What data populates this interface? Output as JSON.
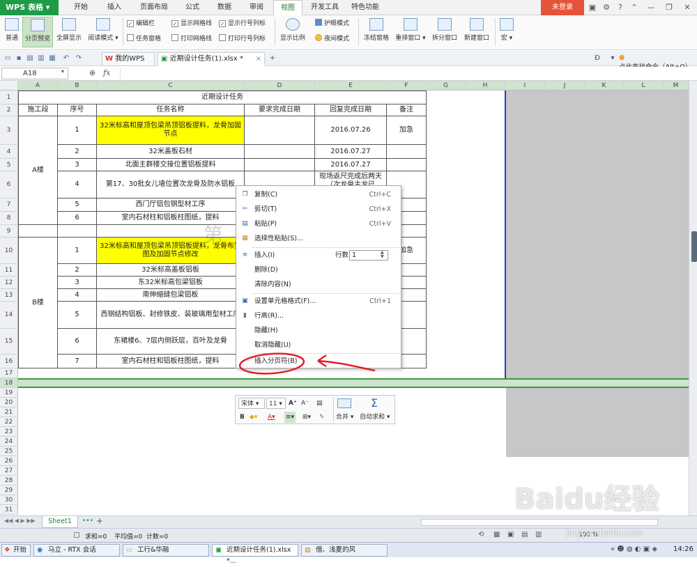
{
  "app": {
    "title": "WPS 表格",
    "login_label": "未登录"
  },
  "menu": {
    "tabs": [
      "开始",
      "插入",
      "页面布局",
      "公式",
      "数据",
      "审阅",
      "视图",
      "开发工具",
      "特色功能"
    ],
    "active": "视图"
  },
  "ribbon": {
    "normal": "普通",
    "page_break_preview": "分页预览",
    "full_screen": "全屏显示",
    "reading_mode": "阅读模式",
    "checks": {
      "formula_bar": "编辑栏",
      "task_pane": "任务窗格",
      "show_gridlines": "显示网格线",
      "print_gridlines": "打印网格线",
      "show_headers": "显示行号列标",
      "print_headers": "打印行号列标"
    },
    "zoom": "显示比例",
    "eye_mode": "护眼模式",
    "night_mode": "夜间模式",
    "freeze": "冻结窗格",
    "arrange": "重排窗口",
    "split": "拆分窗口",
    "new_window": "新建窗口",
    "macro": "宏"
  },
  "doctabs": {
    "home": "我的WPS",
    "file": "近期设计任务(1).xlsx *",
    "search": "点此查找命令（Alt+Q）"
  },
  "formula": {
    "name_box": "A18",
    "fx": "fx"
  },
  "columns": [
    "A",
    "B",
    "C",
    "D",
    "E",
    "F",
    "G",
    "H",
    "I",
    "J",
    "K",
    "L",
    "M"
  ],
  "rows": [
    "1",
    "2",
    "3",
    "4",
    "5",
    "6",
    "7",
    "8",
    "9",
    "10",
    "11",
    "12",
    "13",
    "14",
    "15",
    "16",
    "17",
    "18",
    "19",
    "20",
    "21",
    "22",
    "23",
    "24",
    "25",
    "26",
    "27",
    "28",
    "29",
    "30",
    "31",
    "32",
    "33",
    "34"
  ],
  "table": {
    "title": "近期设计任务",
    "headers": [
      "施工段",
      "序号",
      "任务名称",
      "要求完成日期",
      "回复完成日期",
      "备注"
    ],
    "section_a": "A楼",
    "section_b": "B楼",
    "rows_a": [
      {
        "no": "1",
        "task": "32米标高和屋顶包梁吊顶铝板提料，龙骨加固节点",
        "reply": "2016.07.26",
        "note": "加急"
      },
      {
        "no": "2",
        "task": "32米盖板石材",
        "reply": "2016.07.27",
        "note": ""
      },
      {
        "no": "3",
        "task": "北面主群楼交接位置铝板提料",
        "reply": "2016.07.27",
        "note": ""
      },
      {
        "no": "4",
        "task": "第17、30批女儿墙位置次龙骨及防水铝板",
        "reply": "现场返尺完成后两天（次龙骨主龙已",
        "note": ""
      },
      {
        "no": "5",
        "task": "西门厅铝包钢型材工序",
        "reply": "",
        "note": ""
      },
      {
        "no": "6",
        "task": "室内石材柱和铝板柱图纸，提料",
        "reply": "",
        "note": ""
      }
    ],
    "rows_b": [
      {
        "no": "1",
        "task": "32米标高和屋顶包梁吊顶铝板提料，龙骨布置图及加固节点修改",
        "reply": "",
        "note": "加急"
      },
      {
        "no": "2",
        "task": "32米标高盖板铝板",
        "reply": "",
        "note": ""
      },
      {
        "no": "3",
        "task": "东32米标高包梁铝板",
        "reply": "",
        "note": ""
      },
      {
        "no": "4",
        "task": "南伸缩缝包梁铝板",
        "reply": "",
        "note": ""
      },
      {
        "no": "5",
        "task": "西钢结构铝板、封修铁皮、装玻璃用型材工序",
        "reply": "",
        "note": ""
      },
      {
        "no": "6",
        "task": "东裙楼6、7层内侧跃层，百叶及龙骨",
        "reply": "",
        "note": ""
      },
      {
        "no": "7",
        "task": "室内石材柱和铝板柱图纸，提料",
        "reply": "",
        "note": ""
      }
    ],
    "watermark": "第"
  },
  "context_menu": {
    "copy": "复制(C)",
    "copy_sc": "Ctrl+C",
    "cut": "剪切(T)",
    "cut_sc": "Ctrl+X",
    "paste": "粘贴(P)",
    "paste_sc": "Ctrl+V",
    "paste_special": "选择性粘贴(S)...",
    "insert": "插入(I)",
    "rows_label": "行数:",
    "rows_value": "1",
    "delete": "删除(D)",
    "clear": "清除内容(N)",
    "format": "设置单元格格式(F)...",
    "format_sc": "Ctrl+1",
    "row_height": "行高(R)...",
    "hide": "隐藏(H)",
    "unhide": "取消隐藏(U)",
    "insert_page_break": "插入分页符(B)"
  },
  "mini_toolbar": {
    "font": "宋体",
    "size": "11",
    "merge": "合并",
    "autosum": "自动求和"
  },
  "sheettab": "Sheet1",
  "status": {
    "sum": "求和=0",
    "avg": "平均值=0",
    "count": "计数=0",
    "zoom": "100 %"
  },
  "taskbar": {
    "start": "开始",
    "t1": "马立 - RTX 会话",
    "t2": "工行&华融",
    "t3": "近期设计任务(1).xlsx *...",
    "t4": "借、浅夏的风",
    "clock": "14:26"
  },
  "watermark_site": "Baidu经验",
  "watermark_url": "jingyan.baidu.com",
  "colors": {
    "accent_green": "#1e9b46",
    "login_red": "#e5533a",
    "highlight_yellow": "#ffff00",
    "annotation_red": "#e0202a"
  }
}
